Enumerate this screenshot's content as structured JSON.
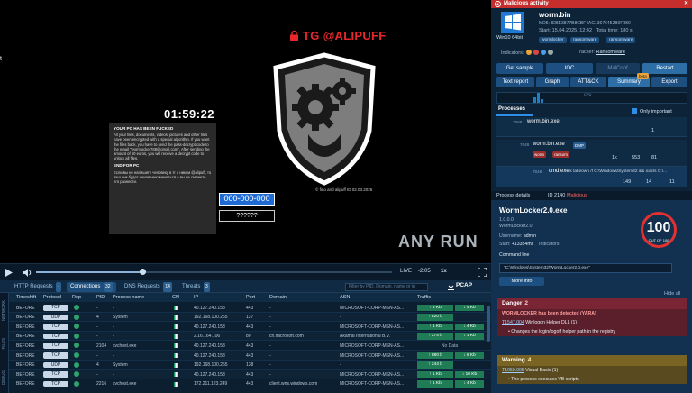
{
  "vm": {
    "tg_text": "TG @ALIPUFF",
    "timer": "01:59:22",
    "note_title": "YOUR PC HAS BEEN FUCKED",
    "note_body": "All your files, documents, videos, pictures and other files have been encrypted with a special algorithm. If you want the files back, you have to send the pass-decrypt code to the email \"wormlocker788@gmail.com\". After sending the amount of 50 euros, you will receive a decrypt code to unlock all files.",
    "note_sub": "END FOR PC",
    "note_ru": "Если вы не напишите человеку в тг с ником @alipuff, то ваш ник будет неизменно меняться а вы не сможете его разнести.",
    "id_value": "000-000-000",
    "password_placeholder": "??????",
    "credit": "© fino and alipuff  ID 02.03.2025",
    "anyrun": "ANY RUN",
    "left_mark": "t"
  },
  "player": {
    "live": "LIVE",
    "time": "-2:05",
    "speed": "1x",
    "progress": 0.3
  },
  "bottom": {
    "tabs": [
      {
        "label": "HTTP Requests",
        "count": "-"
      },
      {
        "label": "Connections",
        "count": "32"
      },
      {
        "label": "DNS Requests",
        "count": "14"
      },
      {
        "label": "Threats",
        "count": "3"
      }
    ],
    "filter_placeholder": "Filter by PID, Domain, name or ip",
    "pcap": "PCAP",
    "side_tabs": [
      "NETWORK",
      "FILES",
      "DEBUG"
    ],
    "columns": [
      "Timeshift",
      "Protocol",
      "Rep",
      "PID",
      "Process name",
      "CN",
      "IP",
      "Port",
      "Domain",
      "ASN",
      "Traffic"
    ],
    "rows": [
      {
        "time": "BEFORE",
        "proto": "TCP",
        "pid": "-",
        "proc": "-",
        "ip": "40.127.240.158",
        "port": "443",
        "domain": "-",
        "asn": "MICROSOFT-CORP-MSN-AS...",
        "t1": "↑ 3 Kb",
        "t2": "↓ 4 Kb"
      },
      {
        "time": "BEFORE",
        "proto": "UDP",
        "pid": "4",
        "proc": "System",
        "ip": "192.168.100.255",
        "port": "137",
        "domain": "-",
        "asn": "-",
        "t1": "↑ 820 b",
        "t2": ""
      },
      {
        "time": "BEFORE",
        "proto": "TCP",
        "pid": "-",
        "proc": "-",
        "ip": "40.127.240.158",
        "port": "443",
        "domain": "-",
        "asn": "MICROSOFT-CORP-MSN-AS...",
        "t1": "↑ 1 Kb",
        "t2": "↓ 4 Kb"
      },
      {
        "time": "BEFORE",
        "proto": "TCP",
        "pid": "-",
        "proc": "-",
        "ip": "2.16.164.106",
        "port": "80",
        "domain": "crl.microsoft.com",
        "asn": "Akamai International B.V.",
        "t1": "↑ 274 b",
        "t2": "↓ 1 Kb"
      },
      {
        "time": "BEFORE",
        "proto": "TCP",
        "pid": "2104",
        "proc": "svchost.exe",
        "ip": "40.127.240.158",
        "port": "443",
        "domain": "-",
        "asn": "MICROSOFT-CORP-MSN-AS...",
        "nodata": "No Data"
      },
      {
        "time": "BEFORE",
        "proto": "TCP",
        "pid": "-",
        "proc": "-",
        "ip": "40.127.240.158",
        "port": "443",
        "domain": "-",
        "asn": "MICROSOFT-CORP-MSN-AS...",
        "t1": "↑ 880 b",
        "t2": "↓ 6 Kb"
      },
      {
        "time": "BEFORE",
        "proto": "UDP",
        "pid": "4",
        "proc": "System",
        "ip": "192.168.100.255",
        "port": "138",
        "domain": "-",
        "asn": "-",
        "t1": "↑ 244 b",
        "t2": ""
      },
      {
        "time": "BEFORE",
        "proto": "TCP",
        "pid": "-",
        "proc": "-",
        "ip": "40.127.240.158",
        "port": "443",
        "domain": "-",
        "asn": "MICROSOFT-CORP-MSN-AS...",
        "t1": "↑ 1 Kb",
        "t2": "↓ 10 Kb"
      },
      {
        "time": "BEFORE",
        "proto": "TCP",
        "pid": "2216",
        "proc": "svchost.exe",
        "ip": "172.211.123.249",
        "port": "443",
        "domain": "client.wns.windows.com",
        "asn": "MICROSOFT-CORP-MSN-AS...",
        "t1": "↑ 1 Kb",
        "t2": "↓ 4 Kb"
      }
    ]
  },
  "right": {
    "header": "Malicious activity",
    "os_label": "Win10 64bit",
    "file_name": "worm.bin",
    "md5": "MD5: 828E3877B8CBF4AC13676452B0F880",
    "start": "Start: 15.04.2025, 12:42",
    "total": "Total time: 180 s",
    "tags": [
      "wormlocker",
      "ransomware",
      "ransomware"
    ],
    "indicators_label": "Indicators:",
    "tracker_label": "Tracker:",
    "tracker_value": "Ransomware",
    "buttons_row1": [
      "Get sample",
      "IOC",
      "MalConf",
      "Restart"
    ],
    "buttons_row2": [
      "Text report",
      "Graph",
      "ATT&CK",
      "Summary",
      "Export"
    ],
    "beta": "beta",
    "cpu_label": "CPU",
    "processes_tab": "Processes",
    "only_important": "Only important",
    "processes": [
      {
        "pid": "7568",
        "name": "worm.bin.exe",
        "args": "",
        "s1": "1",
        "s2": "",
        "s3": "",
        "s4": ""
      },
      {
        "pid": "7648",
        "name": "worm.bin.exe",
        "args": "",
        "badge": "DMP",
        "s1": "1k",
        "s2": "553",
        "s3": "81"
      },
      {
        "pid": "7848",
        "name": "cmd.exe",
        "args": "/k takeown /f C:\\Windows\\System32 && icacls C:\\...",
        "s1": "149",
        "s2": "14",
        "s3": "11"
      }
    ],
    "pd_header": {
      "title": "Process details",
      "id": "ID 2140",
      "status": "Malicious"
    },
    "pd": {
      "name": "WormLocker2.0.exe",
      "version": "1.0.0.0",
      "desc": "WormLocker2.0",
      "user_label": "Username:",
      "user": "admin",
      "start_label": "Start:",
      "start": "+13354ms",
      "indicators_label": "Indicators:",
      "cmd_label": "Command line",
      "cmd": "\"C:\\Windows\\System32\\WormLocker2.0.exe\"",
      "more_info": "More info",
      "score": "100",
      "score_text": "OUT OF 100",
      "hide_all": "Hide all"
    },
    "danger": {
      "title": "Danger",
      "count": "2",
      "items": [
        {
          "text": "WORMLOCKER has been detected (YARA)"
        },
        {
          "link": "T1547.004",
          "text": " Winlogon Helper DLL (1)"
        },
        {
          "text": "• Changes the login/logoff helper path in the registry"
        }
      ]
    },
    "warning": {
      "title": "Warning",
      "count": "4",
      "items": [
        {
          "link": "T1059.005",
          "text": " Visual Basic (1)"
        },
        {
          "text": "• The process executes VB scripts"
        }
      ]
    }
  }
}
